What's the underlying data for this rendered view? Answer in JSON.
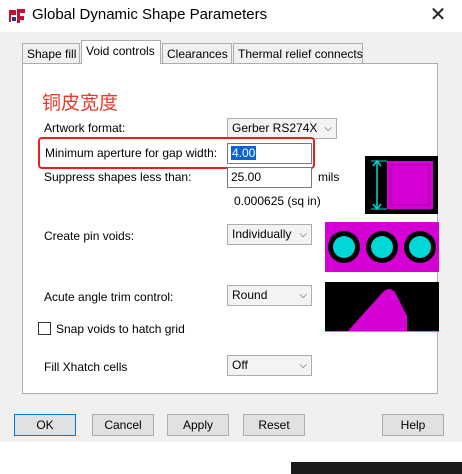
{
  "window": {
    "title": "Global Dynamic Shape Parameters",
    "close_glyph": "✕"
  },
  "tabs": [
    {
      "label": "Shape fill"
    },
    {
      "label": "Void controls"
    },
    {
      "label": "Clearances"
    },
    {
      "label": "Thermal relief connects"
    }
  ],
  "annotation": {
    "text": "铜皮宽度",
    "color": "#e83b2a"
  },
  "form": {
    "artwork_format": {
      "label": "Artwork format:",
      "value": "Gerber RS274X"
    },
    "min_aperture": {
      "label": "Minimum aperture for gap width:",
      "value": "4.00"
    },
    "suppress_shapes": {
      "label": "Suppress shapes less than:",
      "value": "25.00",
      "unit": "mils",
      "area": "0.000625 (sq in)"
    },
    "pin_voids": {
      "label": "Create pin voids:",
      "value": "Individually"
    },
    "acute_angle": {
      "label": "Acute angle trim control:",
      "value": "Round"
    },
    "snap_voids": {
      "label": "Snap voids to hatch grid",
      "checked": false
    },
    "fill_xhatch": {
      "label": "Fill Xhatch cells",
      "value": "Off"
    }
  },
  "buttons": {
    "ok": "OK",
    "cancel": "Cancel",
    "apply": "Apply",
    "reset": "Reset",
    "help": "Help"
  },
  "colors": {
    "accent_magenta": "#d400d4",
    "pin_cyan": "#00d8d8",
    "highlight_red": "#e8211f",
    "selection_blue": "#0a64d6"
  }
}
